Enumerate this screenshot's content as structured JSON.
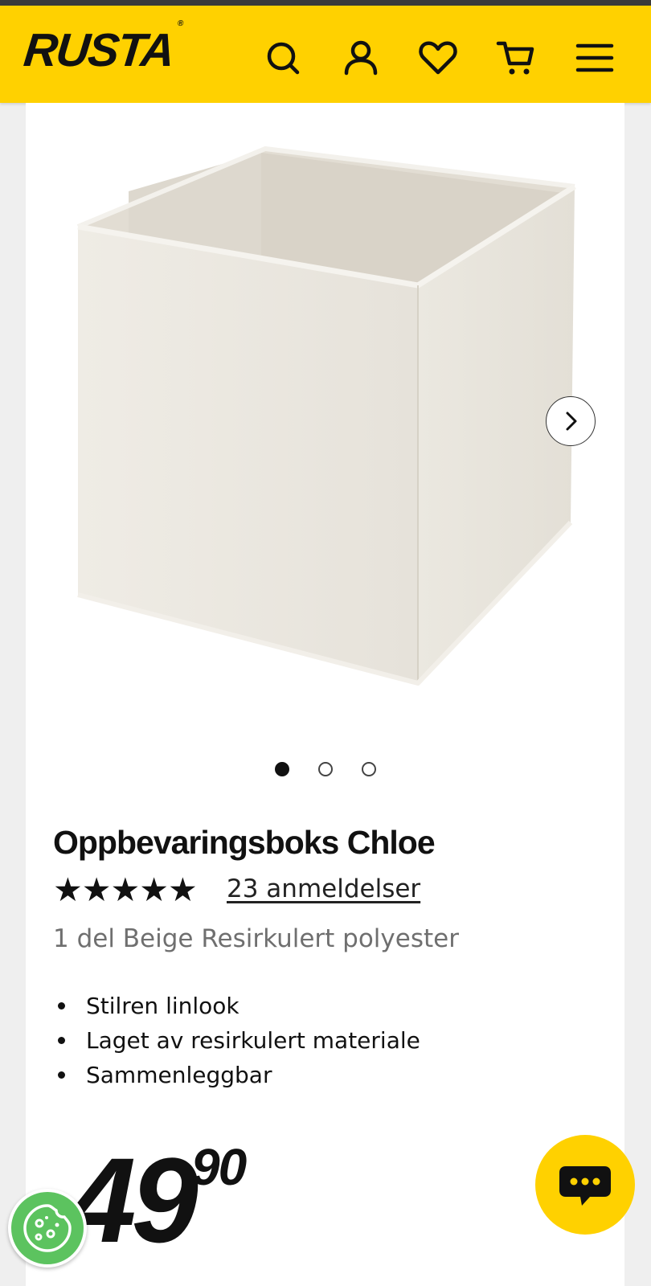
{
  "header": {
    "logo": "RUSTA",
    "icons": [
      "search-icon",
      "account-icon",
      "heart-icon",
      "cart-icon",
      "menu-icon"
    ],
    "background_color": "#ffd100"
  },
  "product": {
    "title": "Oppbevaringsboks Chloe",
    "rating": 5,
    "stars": "★★★★★",
    "reviews_label": "23 anmeldelser",
    "variant": "1 del Beige Resirkulert polyester",
    "features": [
      "Stilren linlook",
      "Laget av resirkulert materiale",
      "Sammenleggbar"
    ],
    "price_integer": "49",
    "price_decimal": "90"
  },
  "gallery": {
    "image_count": 3,
    "active_index": 0
  },
  "colors": {
    "brand_yellow": "#ffd100",
    "cookie_green": "#5cc35f"
  }
}
